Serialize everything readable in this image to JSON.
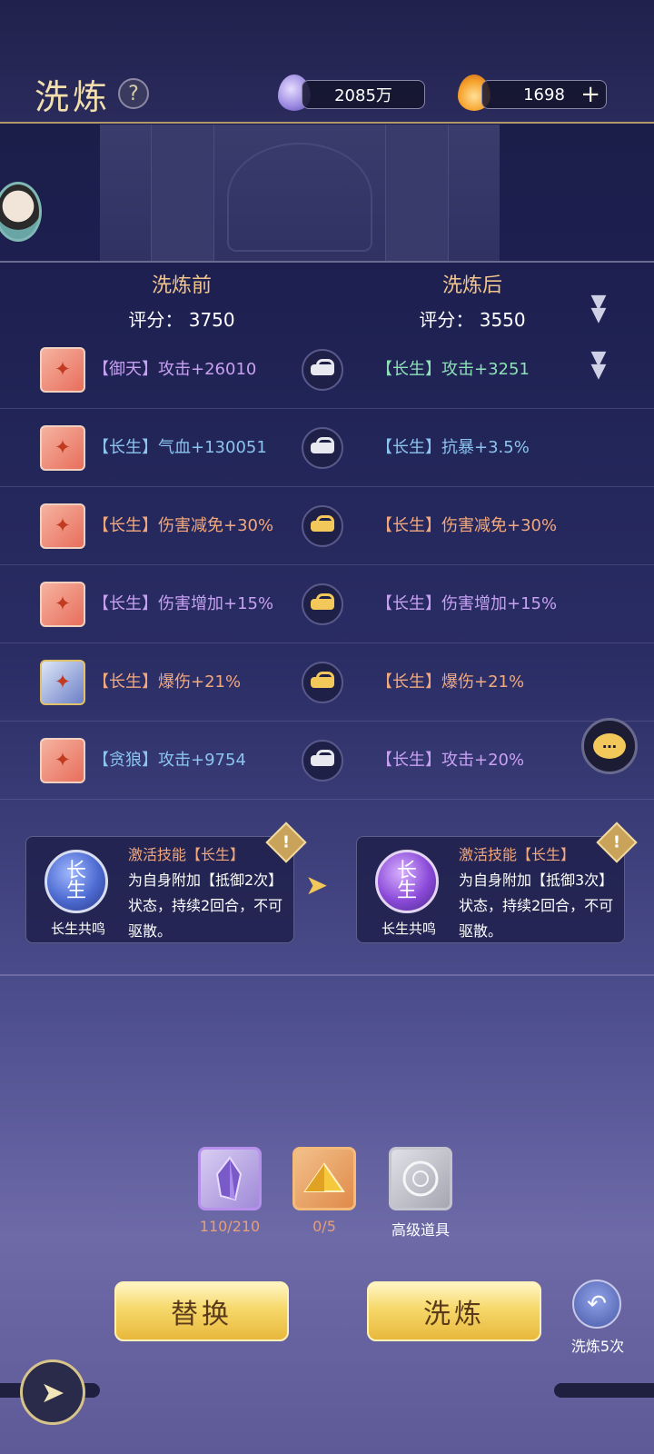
{
  "header": {
    "title": "洗炼",
    "help_icon": "?",
    "currency_a": {
      "value": "2085万",
      "icon": "spirit-drop-icon",
      "color": "#b7a6f2"
    },
    "currency_b": {
      "value": "1698",
      "icon": "flame-icon",
      "color": "#f0a02a",
      "plus": "+"
    }
  },
  "compare": {
    "before": {
      "label": "洗炼前",
      "score_label": "评分：",
      "score": "3750"
    },
    "after": {
      "label": "洗炼后",
      "score_label": "评分：",
      "score": "3550"
    }
  },
  "rows": [
    {
      "icon": "weapon-icon",
      "before": "【御天】攻击+26010",
      "before_color": "purple",
      "locked": false,
      "after": "【长生】攻击+3251",
      "after_color": "green"
    },
    {
      "icon": "armor-icon",
      "before": "【长生】气血+130051",
      "before_color": "blue",
      "locked": false,
      "after": "【长生】抗暴+3.5%",
      "after_color": "blue"
    },
    {
      "icon": "helmet-icon",
      "before": "【长生】伤害减免+30%",
      "before_color": "orange",
      "locked": true,
      "after": "【长生】伤害减免+30%",
      "after_color": "orange"
    },
    {
      "icon": "boots-icon",
      "before": "【长生】伤害增加+15%",
      "before_color": "purple",
      "locked": true,
      "after": "【长生】伤害增加+15%",
      "after_color": "purple"
    },
    {
      "icon": "bracelet-icon",
      "before": "【长生】爆伤+21%",
      "before_color": "orange",
      "locked": true,
      "after": "【长生】爆伤+21%",
      "after_color": "orange"
    },
    {
      "icon": "pendant-icon",
      "before": "【贪狼】攻击+9754",
      "before_color": "blue",
      "locked": false,
      "after": "【长生】攻击+20%",
      "after_color": "purple"
    }
  ],
  "skill_before": {
    "orb_text": "长生",
    "name": "长生共鸣",
    "title": "激活技能【长生】",
    "desc": "为自身附加【抵御2次】状态，持续2回合，不可驱散。"
  },
  "skill_after": {
    "orb_text": "长生",
    "name": "长生共鸣",
    "title": "激活技能【长生】",
    "desc": "为自身附加【抵御3次】状态，持续2回合，不可驱散。"
  },
  "items": [
    {
      "icon": "crystal-icon",
      "label": "110/210",
      "color": "#e4a07a"
    },
    {
      "icon": "gold-ingot-icon",
      "label": "0/5",
      "color": "#e4a07a"
    },
    {
      "icon": "advanced-item-icon",
      "label": "高级道具",
      "color": "#ffffff"
    }
  ],
  "buttons": {
    "replace": "替换",
    "refine": "洗炼",
    "refine5": "洗炼5次"
  }
}
